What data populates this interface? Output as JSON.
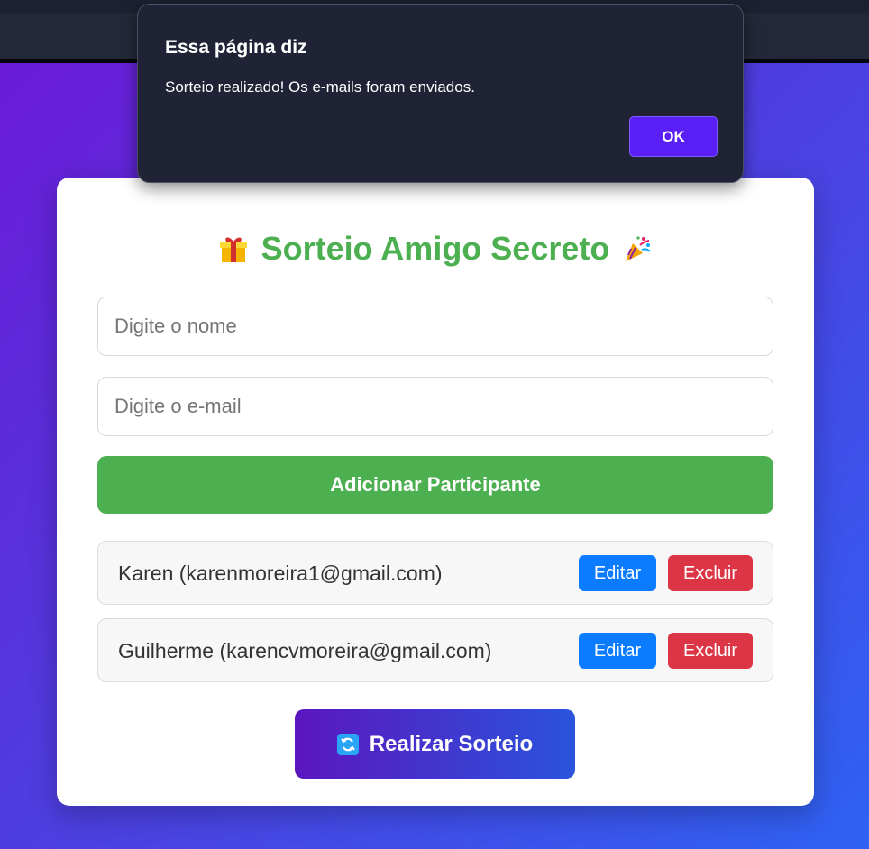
{
  "dialog": {
    "title": "Essa página diz",
    "message": "Sorteio realizado! Os e-mails foram enviados.",
    "ok_label": "OK"
  },
  "app": {
    "title": "Sorteio Amigo Secreto",
    "title_left_icon": "gift-icon",
    "title_right_icon": "party-popper-icon",
    "name_input": {
      "placeholder": "Digite o nome",
      "value": ""
    },
    "email_input": {
      "placeholder": "Digite o e-mail",
      "value": ""
    },
    "add_button_label": "Adicionar Participante",
    "participants": [
      {
        "text": "Karen (karenmoreira1@gmail.com)",
        "edit_label": "Editar",
        "delete_label": "Excluir"
      },
      {
        "text": "Guilherme (karencvmoreira@gmail.com)",
        "edit_label": "Editar",
        "delete_label": "Excluir"
      }
    ],
    "draw_button_label": "Realizar Sorteio",
    "draw_button_icon": "refresh-icon"
  },
  "colors": {
    "title": "#4caf50",
    "add_button": "#4caf50",
    "edit_button": "#0b7cff",
    "delete_button": "#dc3545",
    "dialog_ok": "#5a1ff6"
  }
}
